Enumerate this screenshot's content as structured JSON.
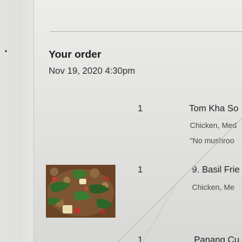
{
  "order": {
    "title": "Your order",
    "date": "Nov 19, 2020 4:30pm"
  },
  "items": [
    {
      "qty": "1",
      "name": "Tom Kha So",
      "options": "Chicken, Med",
      "note": "\"No mushroo"
    },
    {
      "qty": "1",
      "name": "9. Basil Frie",
      "options": "Chicken, Me",
      "image_icon": "food-photo"
    },
    {
      "qty": "1",
      "name": "Panang Cu"
    }
  ],
  "colors": {
    "text": "#1e1e1e",
    "divider": "#b9b9b7",
    "background": "#e4e4e2"
  }
}
